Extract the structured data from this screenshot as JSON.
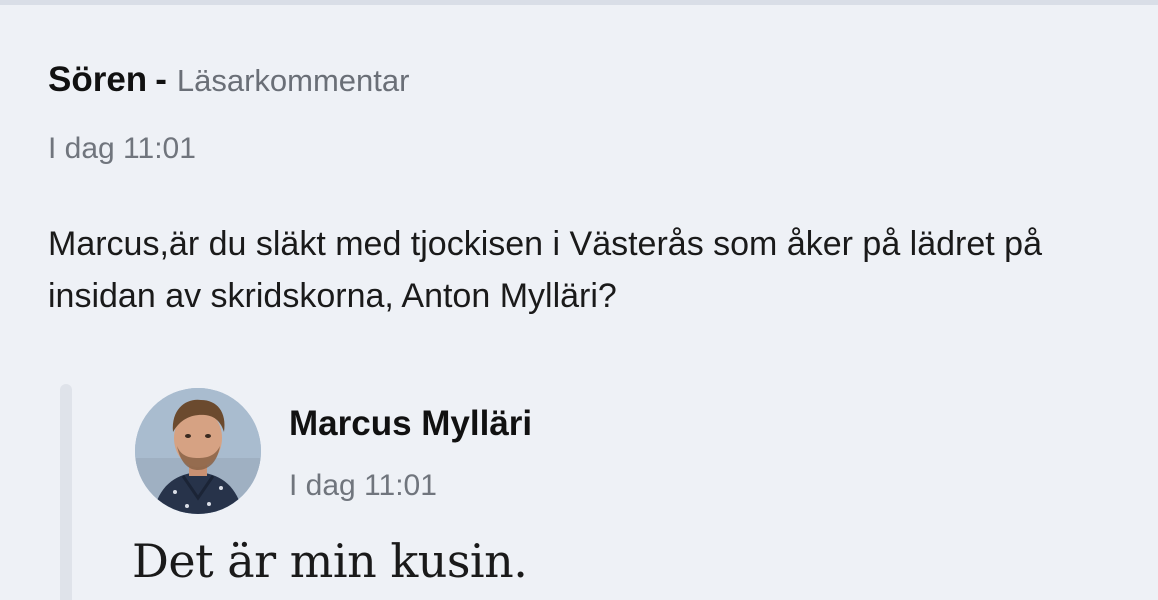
{
  "comment": {
    "author": "Sören",
    "separator": "-",
    "role": "Läsarkommentar",
    "timestamp": "I dag 11:01",
    "body": "Marcus,är du släkt med tjockisen i Västerås som åker på lädret på insidan av skridskorna, Anton Mylläri?"
  },
  "reply": {
    "author": "Marcus Mylläri",
    "timestamp": "I dag 11:01",
    "body": "Det är min kusin.",
    "avatar_icon": "person-avatar-photo"
  },
  "colors": {
    "background": "#eef1f6",
    "muted_text": "#70757d",
    "reply_bar": "#dfe3ea"
  }
}
